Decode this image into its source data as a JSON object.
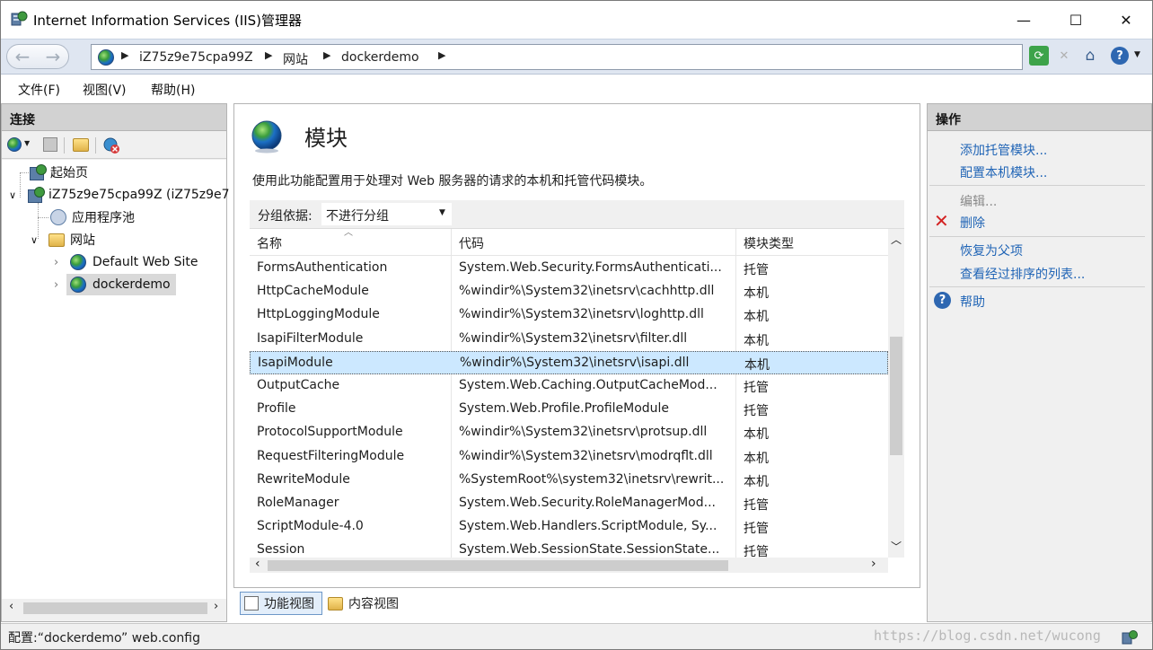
{
  "window": {
    "title": "Internet Information Services (IIS)管理器",
    "minimize": "—",
    "maximize": "☐",
    "close": "✕"
  },
  "address": {
    "crumbs": [
      "iZ75z9e75cpa99Z",
      "网站",
      "dockerdemo"
    ]
  },
  "menu": {
    "file": "文件(F)",
    "view": "视图(V)",
    "help": "帮助(H)"
  },
  "connections": {
    "header": "连接",
    "tree": {
      "start_page": "起始页",
      "server": "iZ75z9e75cpa99Z (iZ75z9e7",
      "app_pools": "应用程序池",
      "sites": "网站",
      "site1": "Default Web Site",
      "site2": "dockerdemo"
    }
  },
  "main": {
    "title": "模块",
    "description": "使用此功能配置用于处理对 Web 服务器的请求的本机和托管代码模块。",
    "group_label": "分组依据:",
    "group_value": "不进行分组",
    "columns": {
      "name": "名称",
      "code": "代码",
      "type": "模块类型"
    },
    "rows": [
      {
        "name": "FormsAuthentication",
        "code": "System.Web.Security.FormsAuthenticati...",
        "type": "托管"
      },
      {
        "name": "HttpCacheModule",
        "code": "%windir%\\System32\\inetsrv\\cachhttp.dll",
        "type": "本机"
      },
      {
        "name": "HttpLoggingModule",
        "code": "%windir%\\System32\\inetsrv\\loghttp.dll",
        "type": "本机"
      },
      {
        "name": "IsapiFilterModule",
        "code": "%windir%\\System32\\inetsrv\\filter.dll",
        "type": "本机"
      },
      {
        "name": "IsapiModule",
        "code": "%windir%\\System32\\inetsrv\\isapi.dll",
        "type": "本机"
      },
      {
        "name": "OutputCache",
        "code": "System.Web.Caching.OutputCacheMod...",
        "type": "托管"
      },
      {
        "name": "Profile",
        "code": "System.Web.Profile.ProfileModule",
        "type": "托管"
      },
      {
        "name": "ProtocolSupportModule",
        "code": "%windir%\\System32\\inetsrv\\protsup.dll",
        "type": "本机"
      },
      {
        "name": "RequestFilteringModule",
        "code": "%windir%\\System32\\inetsrv\\modrqflt.dll",
        "type": "本机"
      },
      {
        "name": "RewriteModule",
        "code": "%SystemRoot%\\system32\\inetsrv\\rewrit...",
        "type": "本机"
      },
      {
        "name": "RoleManager",
        "code": "System.Web.Security.RoleManagerMod...",
        "type": "托管"
      },
      {
        "name": "ScriptModule-4.0",
        "code": "System.Web.Handlers.ScriptModule, Sy...",
        "type": "托管"
      },
      {
        "name": "Session",
        "code": "System.Web.SessionState.SessionState...",
        "type": "托管"
      }
    ],
    "selected_row": "IsapiModule",
    "view_tabs": {
      "feature": "功能视图",
      "content": "内容视图"
    }
  },
  "actions": {
    "header": "操作",
    "add_managed": "添加托管模块...",
    "config_native": "配置本机模块...",
    "edit": "编辑...",
    "delete": "删除",
    "revert": "恢复为父项",
    "view_ordered": "查看经过排序的列表...",
    "help": "帮助"
  },
  "status": {
    "text": "配置:“dockerdemo” web.config",
    "watermark": "https://blog.csdn.net/wucong"
  },
  "colors": {
    "link": "#2165b6",
    "selection": "#cce8ff",
    "pane_header": "#d2d2d2"
  }
}
